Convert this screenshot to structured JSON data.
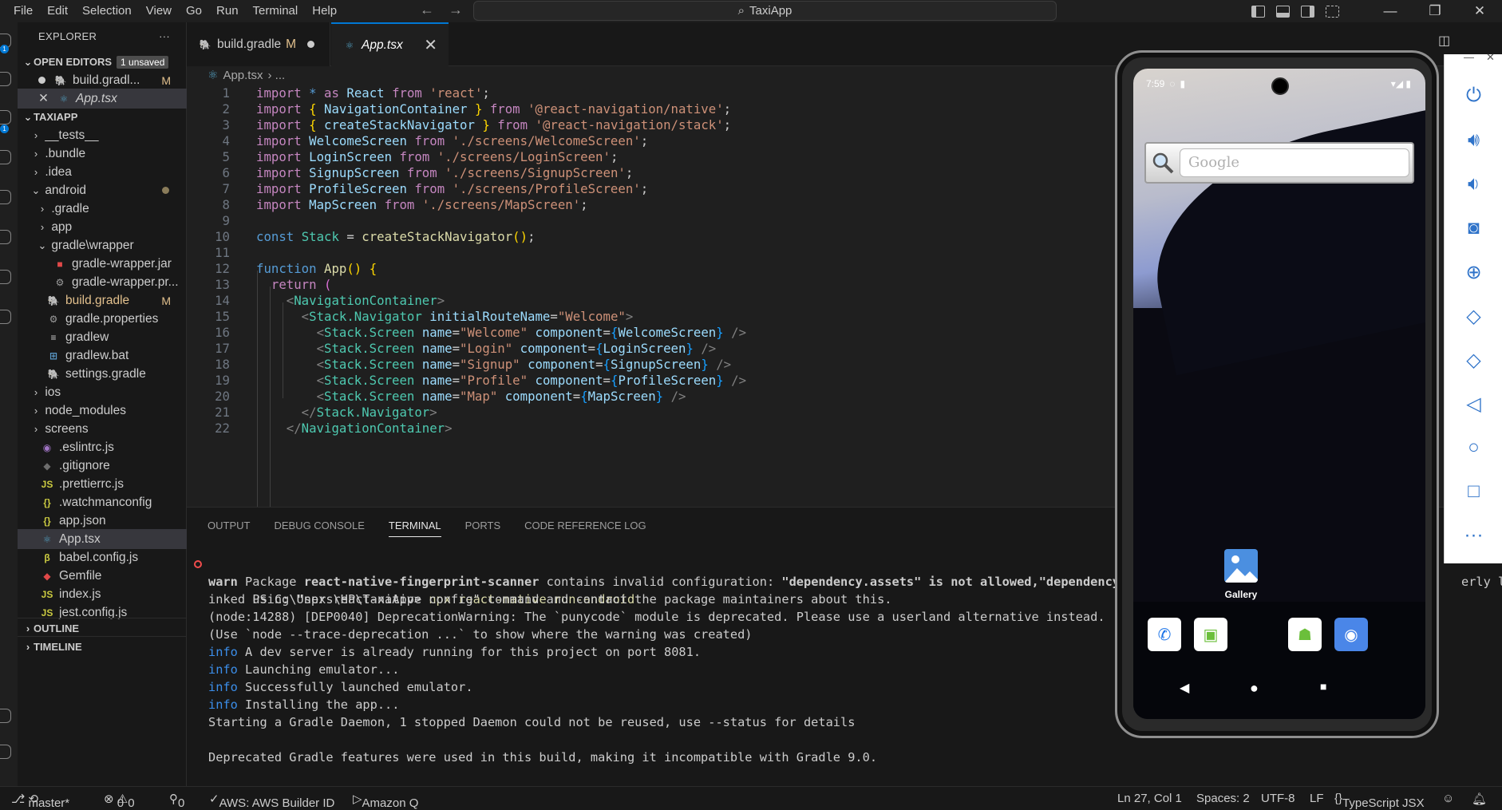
{
  "menu": [
    "File",
    "Edit",
    "Selection",
    "View",
    "Go",
    "Run",
    "Terminal",
    "Help"
  ],
  "search": {
    "label": "TaxiApp"
  },
  "explorer": {
    "title": "EXPLORER",
    "more": "···",
    "open_editors_label": "OPEN EDITORS",
    "unsaved_badge": "1 unsaved",
    "open_editors": [
      {
        "name": "build.gradl...",
        "mark": "M"
      },
      {
        "name": "App.tsx"
      }
    ],
    "project_label": "TAXIAPP",
    "tree": [
      {
        "name": "__tests__",
        "chev": "›"
      },
      {
        "name": ".bundle",
        "chev": "›"
      },
      {
        "name": ".idea",
        "chev": "›"
      },
      {
        "name": "android",
        "chev": "⌄"
      },
      {
        "name": ".gradle",
        "chev": "›"
      },
      {
        "name": "app",
        "chev": "›"
      },
      {
        "name": "gradle\\wrapper",
        "chev": "⌄"
      },
      {
        "name": "gradle-wrapper.jar"
      },
      {
        "name": "gradle-wrapper.pr..."
      },
      {
        "name": "build.gradle",
        "mark": "M"
      },
      {
        "name": "gradle.properties"
      },
      {
        "name": "gradlew"
      },
      {
        "name": "gradlew.bat"
      },
      {
        "name": "settings.gradle"
      },
      {
        "name": "ios",
        "chev": "›"
      },
      {
        "name": "node_modules",
        "chev": "›"
      },
      {
        "name": "screens",
        "chev": "›"
      },
      {
        "name": ".eslintrc.js"
      },
      {
        "name": ".gitignore"
      },
      {
        "name": ".prettierrc.js",
        "icon": "JS"
      },
      {
        "name": ".watchmanconfig",
        "icon": "{}"
      },
      {
        "name": "app.json",
        "icon": "{}"
      },
      {
        "name": "App.tsx"
      },
      {
        "name": "babel.config.js"
      },
      {
        "name": "Gemfile"
      },
      {
        "name": "index.js",
        "icon": "JS"
      },
      {
        "name": "jest.config.js",
        "icon": "JS"
      }
    ],
    "outline_label": "OUTLINE",
    "timeline_label": "TIMELINE"
  },
  "tabs": [
    {
      "name": "build.gradle",
      "mark": "M"
    },
    {
      "name": "App.tsx",
      "close": "✕"
    }
  ],
  "breadcrumb": {
    "file": "App.tsx",
    "rest": "› ..."
  },
  "code_line_numbers": [
    "1",
    "2",
    "3",
    "4",
    "5",
    "6",
    "7",
    "8",
    "9",
    "10",
    "11",
    "12",
    "13",
    "14",
    "15",
    "16",
    "17",
    "18",
    "19",
    "20",
    "21",
    "22"
  ],
  "panel": {
    "tabs": [
      "OUTPUT",
      "DEBUG CONSOLE",
      "TERMINAL",
      "PORTS",
      "CODE REFERENCE LOG"
    ],
    "terminal": {
      "prompt": "PS C:\\Users\\HP\\TaxiApp>",
      "command": "npx react-native run-android",
      "warn_word": "warn",
      "warn_text1": " Package ",
      "warn_pkg": "react-native-fingerprint-scanner",
      "warn_text2": " contains invalid configuration: ",
      "warn_bold": "\"dependency.assets\" is not allowed,\"dependency.h",
      "warn_tail": "erly l",
      "line2": "inked using \"npx react-native config\" command and contact the package maintainers about this.",
      "line3": "(node:14288) [DEP0040] DeprecationWarning: The `punycode` module is deprecated. Please use a userland alternative instead.",
      "line4": "(Use `node --trace-deprecation ...` to show where the warning was created)",
      "info_word": "info",
      "info1": " A dev server is already running for this project on port 8081.",
      "info2": " Launching emulator...",
      "info3": " Successfully launched emulator.",
      "info4": " Installing the app...",
      "line9": "Starting a Gradle Daemon, 1 stopped Daemon could not be reused, use --status for details",
      "line10": "Deprecated Gradle features were used in this build, making it incompatible with Gradle 9.0."
    }
  },
  "emulator": {
    "time": "7:59",
    "search_placeholder": "Google",
    "gallery_label": "Gallery"
  },
  "statusbar": {
    "branch": "master*",
    "errors": "0",
    "warnings": "0",
    "ports": "0",
    "aws": "AWS: AWS Builder ID",
    "amazonq": "Amazon Q",
    "position": "Ln 27, Col 1",
    "spaces": "Spaces: 2",
    "encoding": "UTF-8",
    "eol": "LF",
    "language": "TypeScript JSX"
  },
  "colors": {
    "accent": "#0078d4",
    "modified": "#e2c08d",
    "info": "#3b8eea"
  }
}
